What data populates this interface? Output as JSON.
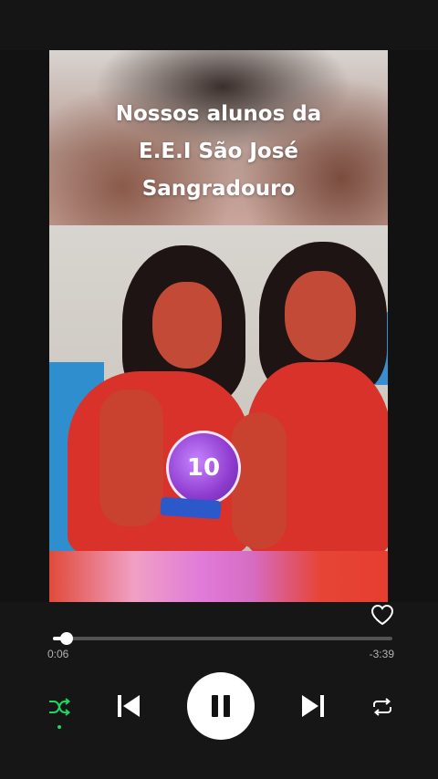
{
  "canvas": {
    "caption_lines": [
      "Nossos alunos da",
      "E.E.I São José",
      "Sangradouro"
    ],
    "trophy_number": "10"
  },
  "player": {
    "elapsed": "0:06",
    "remaining": "-3:39",
    "progress_fraction": 0.04,
    "liked": false,
    "state": "playing",
    "shuffle_active": true,
    "accent_color": "#1ed760"
  },
  "icons": {
    "like": "heart-outline-icon",
    "shuffle": "shuffle-icon",
    "previous": "skip-previous-icon",
    "play_pause": "pause-icon",
    "next": "skip-next-icon",
    "repeat": "repeat-icon"
  }
}
